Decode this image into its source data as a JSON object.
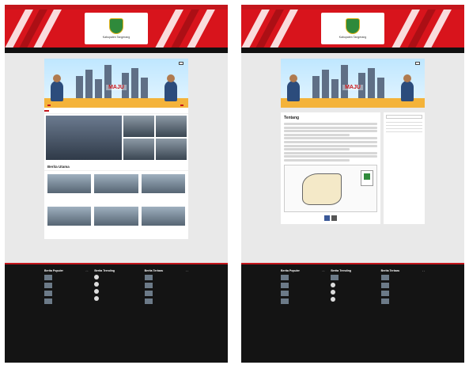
{
  "site": {
    "topbar_left": "",
    "topbar_right": "",
    "brand_text": "Kabupaten Tangerang",
    "accent_color": "#c4161c"
  },
  "nav": {
    "items": [
      "",
      "",
      "",
      ""
    ]
  },
  "hero": {
    "title": "MAJU",
    "subtitle": "",
    "badge": "",
    "left_name": "",
    "right_name": ""
  },
  "ticker": {
    "label": "",
    "text": ""
  },
  "left_page": {
    "featured": {
      "caption": "",
      "meta": ""
    },
    "thumbs": [
      {
        "cat": "",
        "title": ""
      },
      {
        "cat": "",
        "title": ""
      },
      {
        "cat": "",
        "title": ""
      },
      {
        "cat": "",
        "title": ""
      }
    ],
    "section_title": "Berita Utama",
    "cards": [
      {
        "cat": "",
        "title": "",
        "date": ""
      },
      {
        "cat": "",
        "title": "",
        "date": ""
      },
      {
        "cat": "",
        "title": "",
        "date": ""
      },
      {
        "cat": "",
        "title": "",
        "date": ""
      },
      {
        "cat": "",
        "title": "",
        "date": ""
      },
      {
        "cat": "",
        "title": "",
        "date": ""
      }
    ]
  },
  "right_page": {
    "article_title": "Tentang",
    "sidebar": {
      "search_placeholder": "",
      "heading_1": "",
      "heading_2": "",
      "heading_3": "",
      "heading_4": ""
    }
  },
  "footer": {
    "col1_title": "Berita Populer",
    "col2_title": "Berita Trending",
    "col3_title": "Berita Terbaru",
    "copyright": ""
  }
}
